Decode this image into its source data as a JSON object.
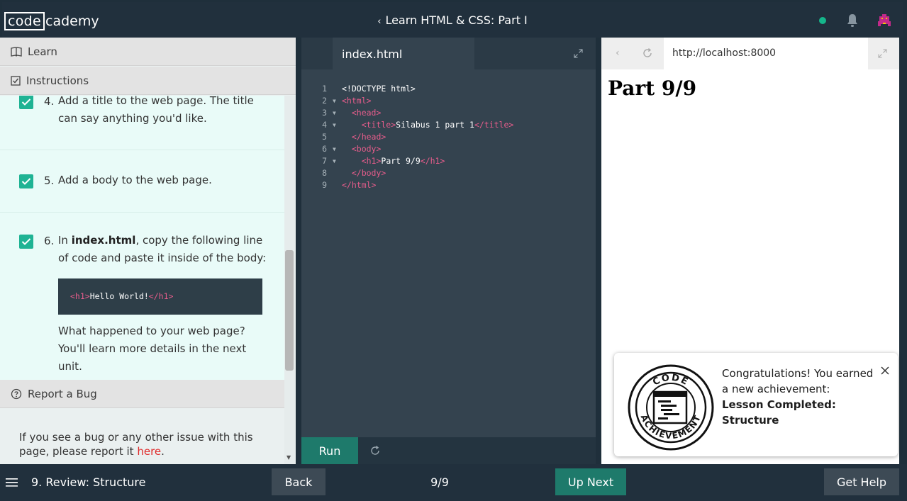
{
  "header": {
    "logo_part1": "code",
    "logo_part2": "cademy",
    "course_title": "Learn HTML & CSS: Part I"
  },
  "left_panel": {
    "learn_label": "Learn",
    "instructions_label": "Instructions",
    "tasks": [
      {
        "num": "4.",
        "text": "Add a title to the web page. The title can say anything you'd like."
      },
      {
        "num": "5.",
        "text": "Add a body to the web page."
      },
      {
        "num": "6.",
        "text_pre": "In ",
        "text_bold": "index.html",
        "text_post": ", copy the following line of code and paste it inside of the body:"
      }
    ],
    "task6_code": {
      "open": "<h1>",
      "inner": "Hello World!",
      "close": "</h1>"
    },
    "task6_followup": "What happened to your web page? You'll learn more details in the next unit.",
    "report_bug_label": "Report a Bug",
    "bug_text": "If you see a bug or any other issue with this page, please report it ",
    "bug_link": "here",
    "bug_period": "."
  },
  "editor": {
    "tab_name": "index.html",
    "lines": [
      {
        "n": "1",
        "fold": "",
        "parts": [
          {
            "t": "<!DOCTYPE html>",
            "c": "text"
          }
        ]
      },
      {
        "n": "2",
        "fold": "▼",
        "parts": [
          {
            "t": "<html>",
            "c": "tag"
          }
        ]
      },
      {
        "n": "3",
        "fold": "▼",
        "parts": [
          {
            "t": "  <head>",
            "c": "tag"
          }
        ]
      },
      {
        "n": "4",
        "fold": "▼",
        "parts": [
          {
            "t": "    <title>",
            "c": "tag"
          },
          {
            "t": "Silabus 1 part 1",
            "c": "text"
          },
          {
            "t": "</title>",
            "c": "tag"
          }
        ]
      },
      {
        "n": "5",
        "fold": "",
        "parts": [
          {
            "t": "  </head>",
            "c": "tag"
          }
        ]
      },
      {
        "n": "6",
        "fold": "▼",
        "parts": [
          {
            "t": "  <body>",
            "c": "tag"
          }
        ]
      },
      {
        "n": "7",
        "fold": "▼",
        "parts": [
          {
            "t": "    <h1>",
            "c": "tag"
          },
          {
            "t": "Part 9/9",
            "c": "text"
          },
          {
            "t": "</h1>",
            "c": "tag"
          }
        ]
      },
      {
        "n": "8",
        "fold": "",
        "parts": [
          {
            "t": "  </body>",
            "c": "tag"
          }
        ]
      },
      {
        "n": "9",
        "fold": "",
        "parts": [
          {
            "t": "</html>",
            "c": "tag"
          }
        ]
      }
    ],
    "run_label": "Run"
  },
  "browser": {
    "url": "http://localhost:8000",
    "preview_heading": "Part 9/9"
  },
  "toast": {
    "badge_top": "CODE",
    "badge_bottom": "ACHIEVEMENT",
    "message": "Congratulations! You earned a new achievement:",
    "achievement": "Lesson Completed: Structure"
  },
  "footer": {
    "lesson_title": "9. Review: Structure",
    "back_label": "Back",
    "progress": "9/9",
    "next_label": "Up Next",
    "help_label": "Get Help"
  },
  "colors": {
    "accent": "#1e7a6b",
    "check": "#1fb394",
    "tag": "#e85d8c",
    "link": "#e02b2b",
    "status_dot": "#15b68b"
  }
}
